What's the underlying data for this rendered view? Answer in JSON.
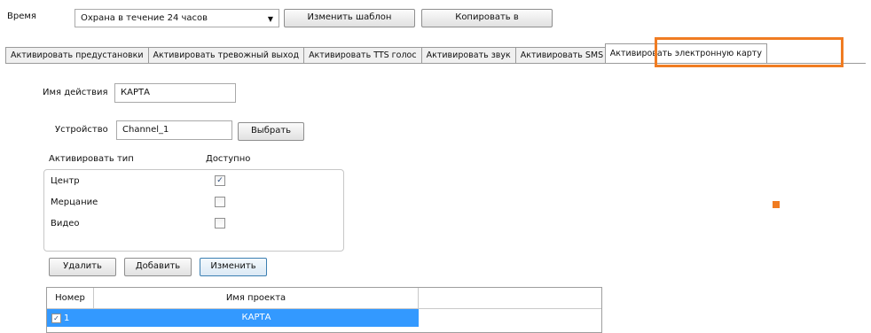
{
  "top": {
    "time_label": "Время",
    "schedule_select": "Охрана в течение 24 часов",
    "change_template_label": "Изменить шаблон",
    "copy_label": "Копировать в"
  },
  "tabs": [
    {
      "label": "Активировать предустановки"
    },
    {
      "label": "Активировать тревожный выход"
    },
    {
      "label": "Активировать TTS голос"
    },
    {
      "label": "Активировать звук"
    },
    {
      "label": "Активировать SMS"
    },
    {
      "label": "Активировать электронную карту"
    }
  ],
  "form": {
    "action_name_label": "Имя действия",
    "action_name_value": "КАРТА",
    "device_label": "Устройство",
    "device_value": "Channel_1",
    "select_button": "Выбрать",
    "activate_type_label": "Активировать тип",
    "available_label": "Доступно",
    "types": [
      {
        "label": "Центр",
        "checked": true
      },
      {
        "label": "Мерцание",
        "checked": false
      },
      {
        "label": "Видео",
        "checked": false
      }
    ],
    "delete_button": "Удалить",
    "add_button": "Добавить",
    "edit_button": "Изменить"
  },
  "grid": {
    "col_number": "Номер",
    "col_project": "Имя проекта",
    "rows": [
      {
        "number": "1",
        "project": "КАРТА",
        "checked": true,
        "selected": true
      }
    ]
  },
  "colors": {
    "highlight": "#f07c22",
    "selection": "#3399ff"
  }
}
